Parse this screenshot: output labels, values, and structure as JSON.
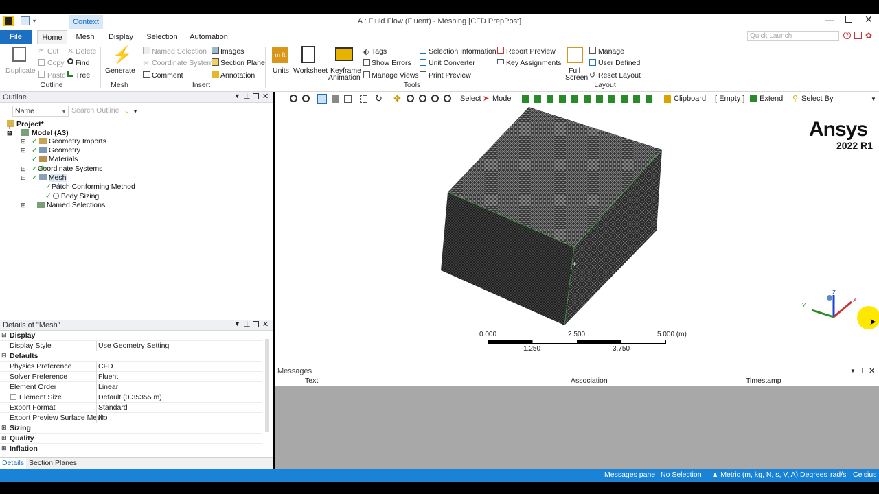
{
  "window": {
    "title": "A : Fluid Flow (Fluent) - Meshing [CFD PrepPost]",
    "context_tab": "Context"
  },
  "menu": {
    "tabs": [
      "File",
      "Home",
      "Mesh",
      "Display",
      "Selection",
      "Automation"
    ],
    "quick_launch_placeholder": "Quick Launch"
  },
  "ribbon": {
    "outline_group": {
      "duplicate": "Duplicate",
      "cut": "Cut",
      "copy": "Copy",
      "paste": "Paste",
      "delete": "Delete",
      "find": "Find",
      "tree": "Tree",
      "label": "Outline"
    },
    "mesh_group": {
      "generate": "Generate",
      "label": "Mesh"
    },
    "insert_group": {
      "named_selection": "Named Selection",
      "coordinate_system": "Coordinate System",
      "comment": "Comment",
      "images": "Images",
      "section_plane": "Section Plane",
      "annotation": "Annotation",
      "label": "Insert"
    },
    "tools_group": {
      "units": "Units",
      "worksheet": "Worksheet",
      "keyframe1": "Keyframe",
      "keyframe2": "Animation",
      "tags": "Tags",
      "show_errors": "Show Errors",
      "manage_views": "Manage Views",
      "selection_information": "Selection Information",
      "unit_converter": "Unit Converter",
      "print_preview": "Print Preview",
      "report_preview": "Report Preview",
      "key_assignments": "Key Assignments",
      "label": "Tools"
    },
    "layout_group": {
      "full1": "Full",
      "full2": "Screen",
      "manage": "Manage",
      "user_defined": "User Defined",
      "reset_layout": "Reset Layout",
      "label": "Layout"
    }
  },
  "outline": {
    "title": "Outline",
    "name_filter": "Name",
    "search_placeholder": "Search Outline",
    "items": [
      "Project*",
      "Model (A3)",
      "Geometry Imports",
      "Geometry",
      "Materials",
      "Coordinate Systems",
      "Mesh",
      "Patch Conforming Method",
      "Body Sizing",
      "Named Selections"
    ]
  },
  "details": {
    "title": "Details of \"Mesh\"",
    "cat_display": "Display",
    "cat_defaults": "Defaults",
    "rows": [
      {
        "k": "Display Style",
        "v": "Use Geometry Setting"
      },
      {
        "k": "Physics Preference",
        "v": "CFD"
      },
      {
        "k": "Solver Preference",
        "v": "Fluent"
      },
      {
        "k": "Element Order",
        "v": "Linear"
      },
      {
        "k": "Element Size",
        "v": "Default (0.35355 m)"
      },
      {
        "k": "Export Format",
        "v": "Standard"
      },
      {
        "k": "Export Preview Surface Mesh",
        "v": "No"
      }
    ],
    "cat_sizing": "Sizing",
    "cat_quality": "Quality",
    "cat_inflation": "Inflation",
    "tabs": [
      "Details",
      "Section Planes"
    ]
  },
  "viewport_toolbar": {
    "select": "Select",
    "mode": "Mode",
    "clipboard": "Clipboard",
    "empty": "[ Empty ]",
    "extend": "Extend",
    "select_by": "Select By"
  },
  "brand": {
    "name": "Ansys",
    "version": "2022 R1"
  },
  "scale": {
    "t0": "0.000",
    "t1": "2.500",
    "t2": "5.000 (m)",
    "b1": "1.250",
    "b2": "3.750"
  },
  "triad": {
    "x": "X",
    "y": "Y",
    "z": "Z"
  },
  "messages": {
    "title": "Messages",
    "col_text": "Text",
    "col_association": "Association",
    "col_timestamp": "Timestamp"
  },
  "status": {
    "messages_pane": "Messages pane",
    "selection": "No Selection",
    "units": "Metric (m, kg, N, s, V, A)",
    "degrees": "Degrees",
    "rads": "rad/s",
    "temp": "Celsius"
  },
  "colors": {
    "accent": "#1883d7",
    "file_tab": "#1c6fc1",
    "mesh_fill": "#3c3c3c"
  }
}
